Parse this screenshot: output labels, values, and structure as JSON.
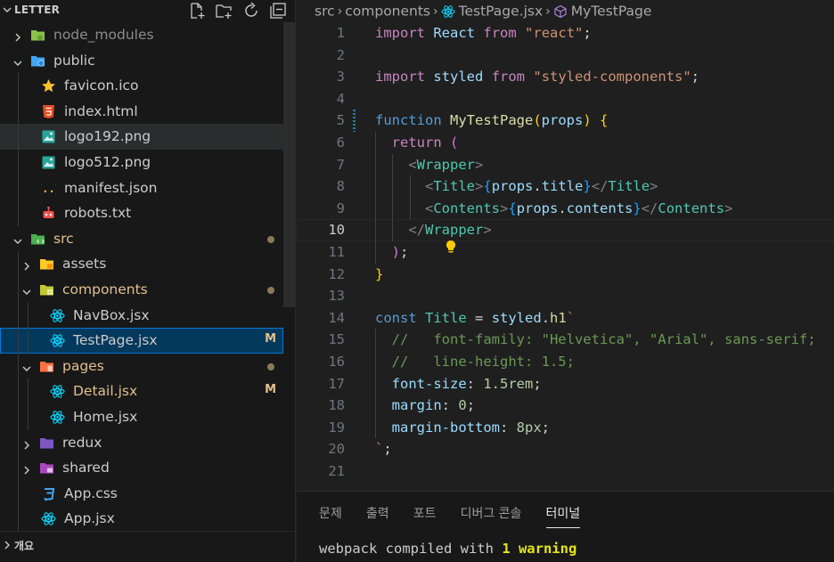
{
  "explorer": {
    "title": "LETTER",
    "outline_label": "개요"
  },
  "tree": [
    {
      "label": "node_modules",
      "icon": "folder-node-icon",
      "type": "folder",
      "open": false,
      "depth": 0,
      "status": "dim"
    },
    {
      "label": "public",
      "icon": "folder-public-icon",
      "type": "folder",
      "open": true,
      "depth": 0
    },
    {
      "label": "favicon.ico",
      "icon": "star-icon",
      "type": "file",
      "depth": 1
    },
    {
      "label": "index.html",
      "icon": "html5-icon",
      "type": "file",
      "depth": 1
    },
    {
      "label": "logo192.png",
      "icon": "image-icon",
      "type": "file",
      "depth": 1,
      "hover": true
    },
    {
      "label": "logo512.png",
      "icon": "image-icon",
      "type": "file",
      "depth": 1
    },
    {
      "label": "manifest.json",
      "icon": "json-braces-icon",
      "type": "file",
      "depth": 1
    },
    {
      "label": "robots.txt",
      "icon": "robot-icon",
      "type": "file",
      "depth": 1
    },
    {
      "label": "src",
      "icon": "folder-src-icon",
      "type": "folder",
      "open": true,
      "depth": 0,
      "status": "mod",
      "dot": true
    },
    {
      "label": "assets",
      "icon": "folder-assets-icon",
      "type": "folder",
      "open": false,
      "depth": 1
    },
    {
      "label": "components",
      "icon": "folder-components-icon",
      "type": "folder",
      "open": true,
      "depth": 1,
      "status": "mod",
      "dot": true
    },
    {
      "label": "NavBox.jsx",
      "icon": "react-icon",
      "type": "file",
      "depth": 2
    },
    {
      "label": "TestPage.jsx",
      "icon": "react-icon",
      "type": "file",
      "depth": 2,
      "selected": true,
      "badge": "M"
    },
    {
      "label": "pages",
      "icon": "folder-pages-icon",
      "type": "folder",
      "open": true,
      "depth": 1,
      "status": "mod",
      "dot": true
    },
    {
      "label": "Detail.jsx",
      "icon": "react-icon",
      "type": "file",
      "depth": 2,
      "status": "mod",
      "badge": "M"
    },
    {
      "label": "Home.jsx",
      "icon": "react-icon",
      "type": "file",
      "depth": 2
    },
    {
      "label": "redux",
      "icon": "folder-redux-icon",
      "type": "folder",
      "open": false,
      "depth": 1
    },
    {
      "label": "shared",
      "icon": "folder-shared-icon",
      "type": "folder",
      "open": false,
      "depth": 1
    },
    {
      "label": "App.css",
      "icon": "css3-icon",
      "type": "file",
      "depth": 1
    },
    {
      "label": "App.jsx",
      "icon": "react-icon",
      "type": "file",
      "depth": 1
    }
  ],
  "breadcrumb": {
    "part1": "src",
    "part2": "components",
    "file": "TestPage.jsx",
    "symbol": "MyTestPage"
  },
  "editor": {
    "current_line": 10,
    "lines": [
      {
        "n": "1"
      },
      {
        "n": "2"
      },
      {
        "n": "3"
      },
      {
        "n": "4"
      },
      {
        "n": "5"
      },
      {
        "n": "6"
      },
      {
        "n": "7"
      },
      {
        "n": "8"
      },
      {
        "n": "9"
      },
      {
        "n": "10"
      },
      {
        "n": "11"
      },
      {
        "n": "12"
      },
      {
        "n": "13"
      },
      {
        "n": "14"
      },
      {
        "n": "15"
      },
      {
        "n": "16"
      },
      {
        "n": "17"
      },
      {
        "n": "18"
      },
      {
        "n": "19"
      },
      {
        "n": "20"
      },
      {
        "n": "21"
      }
    ],
    "tokens": {
      "l1": {
        "import": "import",
        "react": "React",
        "from": "from",
        "str": "\"react\"",
        "semi": ";"
      },
      "l3": {
        "import": "import",
        "styled": "styled",
        "from": "from",
        "str": "\"styled-components\"",
        "semi": ";"
      },
      "l5": {
        "function": "function",
        "name": "MyTestPage",
        "op": "(",
        "props": "props",
        "cp": ")",
        "brace": "{"
      },
      "l6": {
        "return": "return",
        "paren": "("
      },
      "l7": {
        "lt": "<",
        "tag": "Wrapper",
        "gt": ">"
      },
      "l8": {
        "lt": "<",
        "tag": "Title",
        "gt": ">",
        "ob": "{",
        "props": "props",
        "dot": ".",
        "prop": "title",
        "cb": "}",
        "clt": "</",
        "ctag": "Title",
        "cgt": ">"
      },
      "l9": {
        "lt": "<",
        "tag": "Contents",
        "gt": ">",
        "ob": "{",
        "props": "props",
        "dot": ".",
        "prop": "contents",
        "cb": "}",
        "clt": "</",
        "ctag": "Contents",
        "cgt": ">"
      },
      "l10": {
        "clt": "</",
        "ctag": "Wrapper",
        "cgt": ">"
      },
      "l11": {
        "paren": ")",
        "semi": ";"
      },
      "l12": {
        "brace": "}"
      },
      "l14": {
        "const": "const",
        "name": "Title",
        "eq": " = ",
        "styled": "styled",
        "dot": ".",
        "h1": "h1",
        "tick": "`"
      },
      "l15": {
        "comment": "//   font-family: \"Helvetica\", \"Arial\", sans-serif;"
      },
      "l16": {
        "comment": "//   line-height: 1.5;"
      },
      "l17": {
        "prop": "font-size",
        "colon": ": ",
        "val": "1.5rem",
        "semi": ";"
      },
      "l18": {
        "prop": "margin",
        "colon": ": ",
        "val": "0",
        "semi": ";"
      },
      "l19": {
        "prop": "margin-bottom",
        "colon": ": ",
        "val": "8px",
        "semi": ";"
      },
      "l20": {
        "tick": "`",
        "semi": ";"
      }
    }
  },
  "panel": {
    "tabs": [
      "문제",
      "출력",
      "포트",
      "디버그 콘솔",
      "터미널"
    ],
    "active_tab": "터미널",
    "terminal": {
      "prefix": "webpack compiled with ",
      "warning": "1 warning"
    }
  },
  "colors": {
    "selection_bg": "#04395e",
    "selection_border": "#0078d4",
    "modified": "#e2c08d",
    "react": "#00d8ff"
  }
}
